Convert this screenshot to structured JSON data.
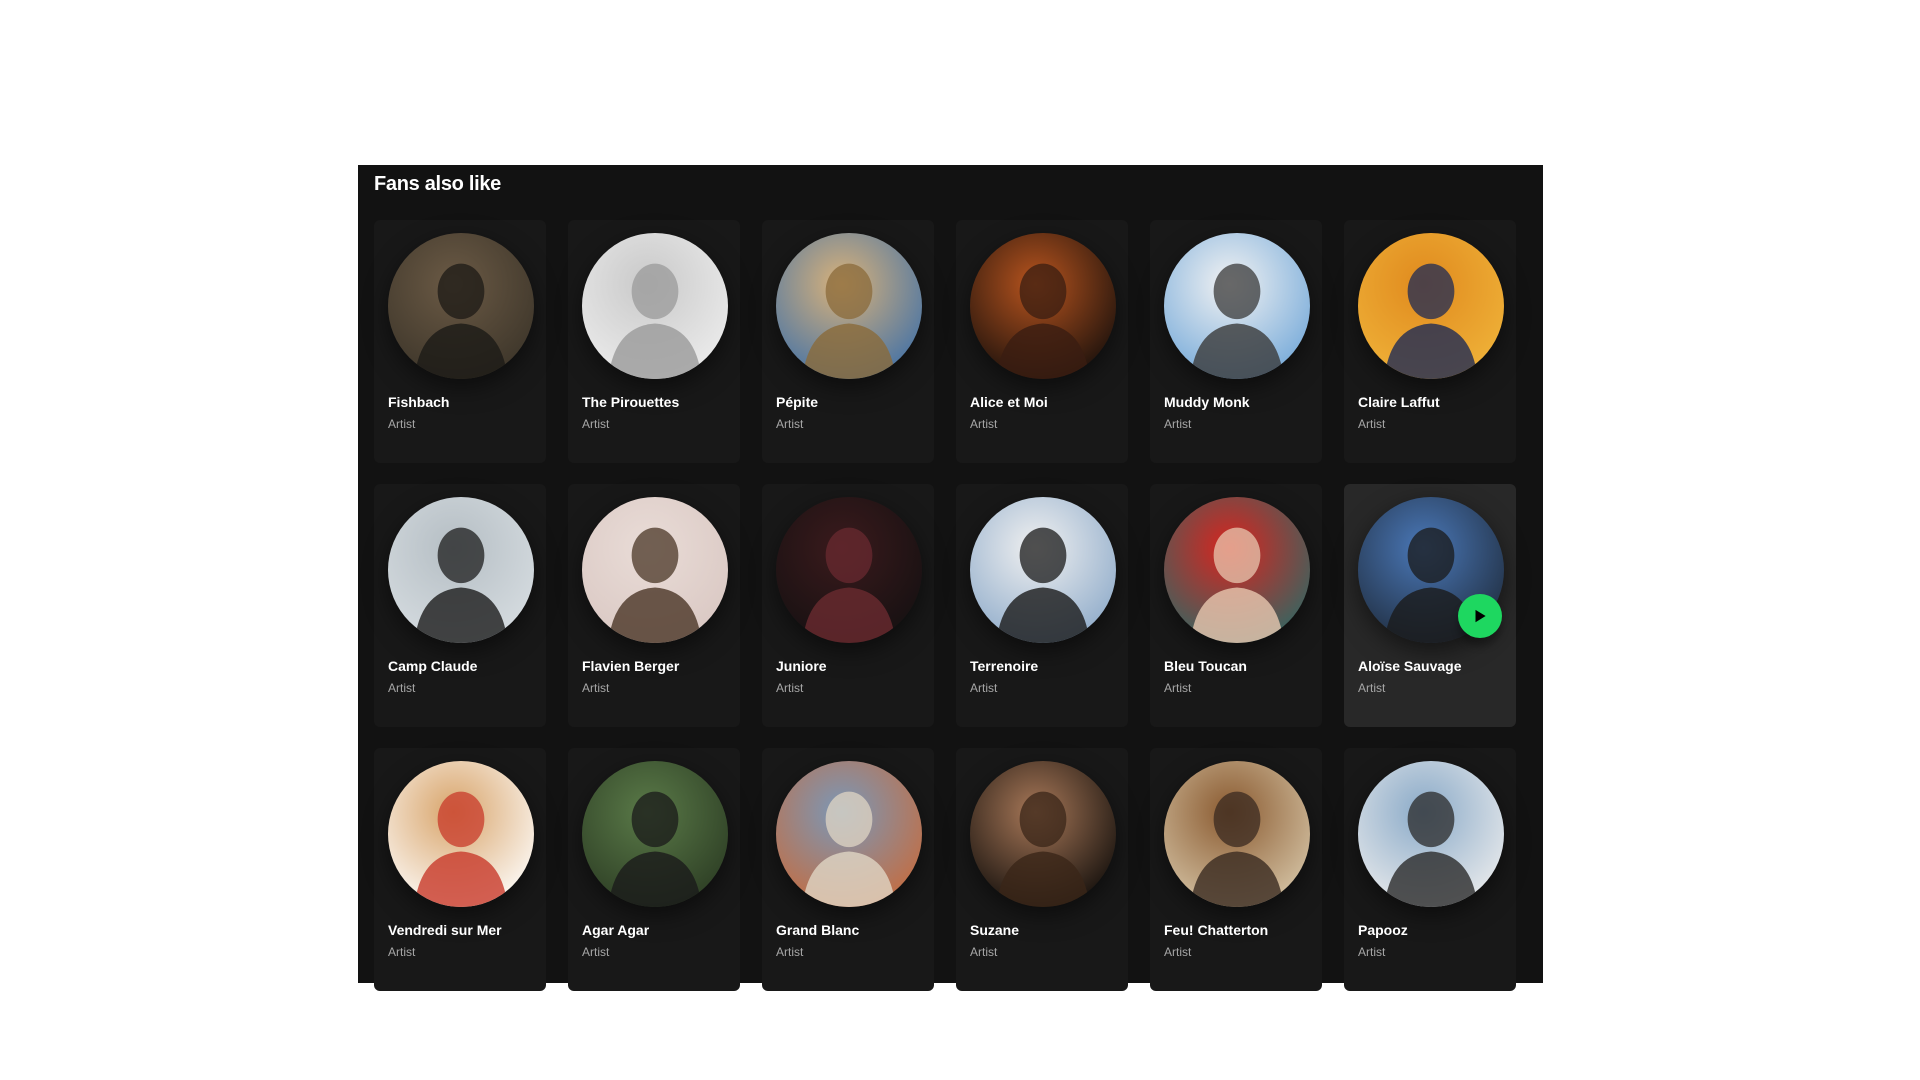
{
  "section": {
    "title": "Fans also like"
  },
  "theme": {
    "panel_bg": "#121212",
    "card_bg": "#181818",
    "card_hover_bg": "#282828",
    "accent": "#1ed760",
    "subtitle_color": "#a7a7a7"
  },
  "artists": [
    {
      "name": "Fishbach",
      "subtitle": "Artist",
      "palette": [
        "#3a3328",
        "#6b5a45",
        "#1c1a16"
      ]
    },
    {
      "name": "The Pirouettes",
      "subtitle": "Artist",
      "palette": [
        "#eeeeee",
        "#c9c9c9",
        "#9a9a9a"
      ]
    },
    {
      "name": "Pépite",
      "subtitle": "Artist",
      "palette": [
        "#3d6fa8",
        "#d9b27a",
        "#8a6a3a"
      ]
    },
    {
      "name": "Alice et Moi",
      "subtitle": "Artist",
      "palette": [
        "#120d0b",
        "#b8541e",
        "#3a1d12"
      ]
    },
    {
      "name": "Muddy Monk",
      "subtitle": "Artist",
      "palette": [
        "#6fa6d8",
        "#f2f2f2",
        "#3a3a3a"
      ]
    },
    {
      "name": "Claire Laffut",
      "subtitle": "Artist",
      "palette": [
        "#f0b43a",
        "#e08a1e",
        "#1e2a55"
      ]
    },
    {
      "name": "Camp Claude",
      "subtitle": "Artist",
      "palette": [
        "#d8dee2",
        "#b5bec4",
        "#1c1c1c"
      ]
    },
    {
      "name": "Flavien Berger",
      "subtitle": "Artist",
      "palette": [
        "#d9c7c2",
        "#e9dcd7",
        "#4a3526"
      ]
    },
    {
      "name": "Juniore",
      "subtitle": "Artist",
      "palette": [
        "#141011",
        "#3a1a1c",
        "#6a2a30"
      ]
    },
    {
      "name": "Terrenoire",
      "subtitle": "Artist",
      "palette": [
        "#8aa8c8",
        "#f0f0f0",
        "#1a1a1a"
      ]
    },
    {
      "name": "Bleu Toucan",
      "subtitle": "Artist",
      "palette": [
        "#2a6a66",
        "#d8241e",
        "#e8c8b0"
      ]
    },
    {
      "name": "Aloïse Sauvage",
      "subtitle": "Artist",
      "palette": [
        "#1e2a3a",
        "#4a78b8",
        "#1a1a1a"
      ]
    },
    {
      "name": "Vendredi sur Mer",
      "subtitle": "Artist",
      "palette": [
        "#ffffff",
        "#d8a46a",
        "#c83a2a"
      ]
    },
    {
      "name": "Agar Agar",
      "subtitle": "Artist",
      "palette": [
        "#2a3a22",
        "#5a7a48",
        "#1a1a1a"
      ]
    },
    {
      "name": "Grand Blanc",
      "subtitle": "Artist",
      "palette": [
        "#c86a3a",
        "#7a98b8",
        "#e0d6c4"
      ]
    },
    {
      "name": "Suzane",
      "subtitle": "Artist",
      "palette": [
        "#0c0a08",
        "#a87858",
        "#3a2618"
      ]
    },
    {
      "name": "Feu! Chatterton",
      "subtitle": "Artist",
      "palette": [
        "#d8c8aa",
        "#8a5a30",
        "#3a2a20"
      ]
    },
    {
      "name": "Papooz",
      "subtitle": "Artist",
      "palette": [
        "#eeeeee",
        "#8aaac8",
        "#2a2a2a"
      ]
    }
  ],
  "hovered_card_index": 11,
  "play_button": {
    "icon": "play-icon"
  }
}
